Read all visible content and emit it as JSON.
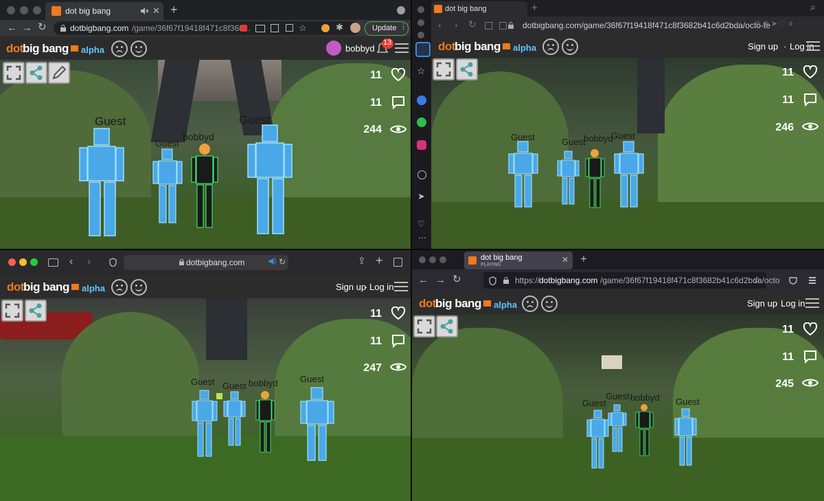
{
  "colors": {
    "brand_orange": "#f07a1c",
    "alpha_blue": "#62c4ff",
    "notif_red": "#e53935",
    "update_green": "#4caf50"
  },
  "site": {
    "logo_dot": "dot",
    "logo_bigbang": "big bang",
    "logo_alpha": "alpha",
    "signup": "Sign up",
    "separator": "·",
    "login": "Log in",
    "username": "bobbyd",
    "notif_count": "13"
  },
  "labels": {
    "guest": "Guest",
    "player": "bobbyd"
  },
  "win1": {
    "tab_title": "dot big bang",
    "address_domain": "dotbigbang.com",
    "address_path": "/game/36f67f19418f471c8f368...",
    "update_label": "Update",
    "likes": "11",
    "comments": "11",
    "views": "244"
  },
  "win2": {
    "tab_title": "dot big bang",
    "address": "dotbigbang.com/game/36f67f19418f471c8f3682b41c6d2bda/octo-te",
    "likes": "11",
    "comments": "11",
    "views": "246"
  },
  "win3": {
    "address": "dotbigbang.com",
    "likes": "11",
    "comments": "11",
    "views": "247"
  },
  "win4": {
    "tab_title": "dot big bang",
    "tab_subtitle": "PLAYING",
    "address_prefix": "https://",
    "address_domain": "dotbigbang.com",
    "address_path": "/game/36f67f19418f471c8f3682b41c6d2bda/octo",
    "likes": "11",
    "comments": "11",
    "views": "245"
  },
  "icons": [
    "fullscreen-icon",
    "share-icon",
    "edit-icon",
    "heart-icon",
    "comment-icon",
    "eye-icon",
    "menu-icon",
    "bell-icon",
    "sad-face-icon",
    "happy-face-icon",
    "back-icon",
    "forward-icon",
    "reload-icon",
    "lock-icon",
    "new-tab-icon"
  ]
}
